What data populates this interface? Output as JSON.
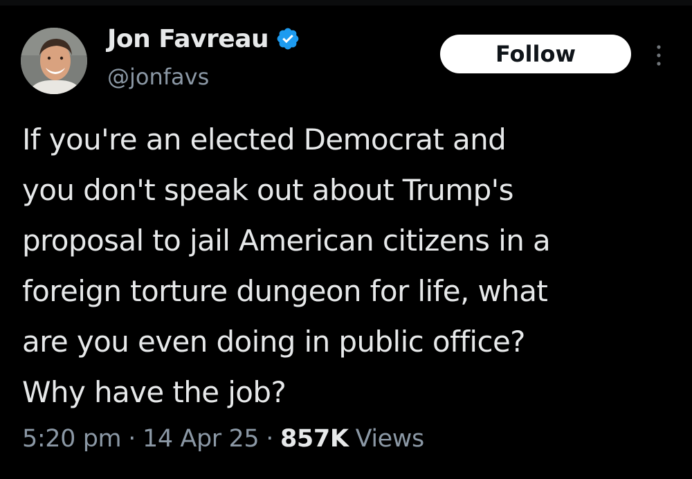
{
  "author": {
    "display_name": "Jon Favreau",
    "handle": "@jonfavs",
    "verified_icon": "verified-badge-icon",
    "verified_color": "#1d9bf0"
  },
  "actions": {
    "follow_label": "Follow",
    "more_icon": "more-vertical-icon"
  },
  "tweet": {
    "lines": [
      "If you're an elected Democrat and",
      "you don't speak out about Trump's",
      "proposal to jail American citizens in a",
      "foreign torture dungeon for life, what",
      "are you even doing in public office?",
      "Why have the job?"
    ]
  },
  "meta": {
    "time": "5:20 pm",
    "separator": "·",
    "date": "14 Apr 25",
    "views_count": "857K",
    "views_label": "Views"
  },
  "colors": {
    "background": "#000000",
    "text_primary": "#e7e9ea",
    "text_secondary": "#8b98a5",
    "button_bg": "#ffffff",
    "button_text": "#0f1419"
  }
}
